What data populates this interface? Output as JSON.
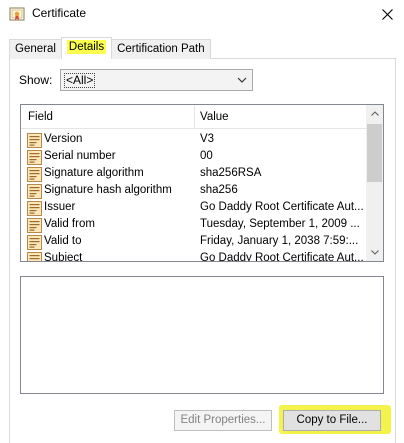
{
  "window": {
    "title": "Certificate",
    "title_icon": "certificate-icon",
    "close_icon": "close-icon"
  },
  "tabs": [
    {
      "label": "General",
      "active": false
    },
    {
      "label": "Details",
      "active": true,
      "highlighted": true
    },
    {
      "label": "Certification Path",
      "active": false
    }
  ],
  "show": {
    "label": "Show:",
    "selected": "<All>"
  },
  "list": {
    "columns": {
      "field": "Field",
      "value": "Value"
    },
    "rows": [
      {
        "field": "Version",
        "value": "V3"
      },
      {
        "field": "Serial number",
        "value": "00"
      },
      {
        "field": "Signature algorithm",
        "value": "sha256RSA"
      },
      {
        "field": "Signature hash algorithm",
        "value": "sha256"
      },
      {
        "field": "Issuer",
        "value": "Go Daddy Root Certificate Aut..."
      },
      {
        "field": "Valid from",
        "value": "Tuesday, September 1, 2009 ..."
      },
      {
        "field": "Valid to",
        "value": "Friday, January 1, 2038 7:59:..."
      },
      {
        "field": "Subject",
        "value": "Go Daddy Root Certificate Aut..."
      }
    ],
    "row_icon": "certificate-field-icon"
  },
  "buttons": {
    "edit_properties": "Edit Properties...",
    "copy_to_file": "Copy to File..."
  },
  "colors": {
    "highlight": "#f3f34b",
    "border": "#828790",
    "disabled_text": "#838383"
  }
}
